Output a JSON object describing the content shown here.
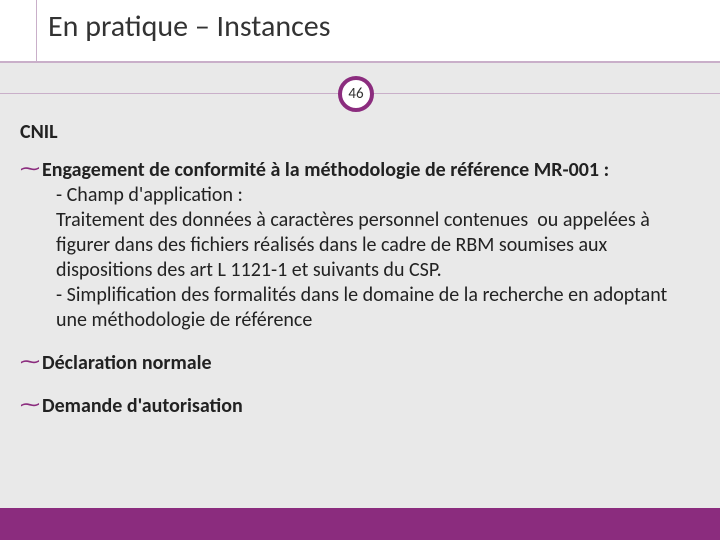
{
  "title": "En pratique – Instances",
  "badge_number": "46",
  "section": "CNIL",
  "bullets": [
    {
      "lead": "Engagement de conformité à la méthodologie de référence MR-001 :",
      "lines": [
        "- Champ d'application :",
        "Traitement des données à caractères personnel contenues  ou appelées à figurer dans des fichiers réalisés dans le cadre de RBM soumises aux dispositions des art L 1121-1 et suivants du CSP.",
        "- Simplification des formalités dans le domaine de la recherche en adoptant une méthodologie de référence"
      ]
    },
    {
      "lead": "Déclaration normale",
      "lines": []
    },
    {
      "lead": "Demande d'autorisation",
      "lines": []
    }
  ],
  "colors": {
    "accent": "#8b2c7e"
  }
}
